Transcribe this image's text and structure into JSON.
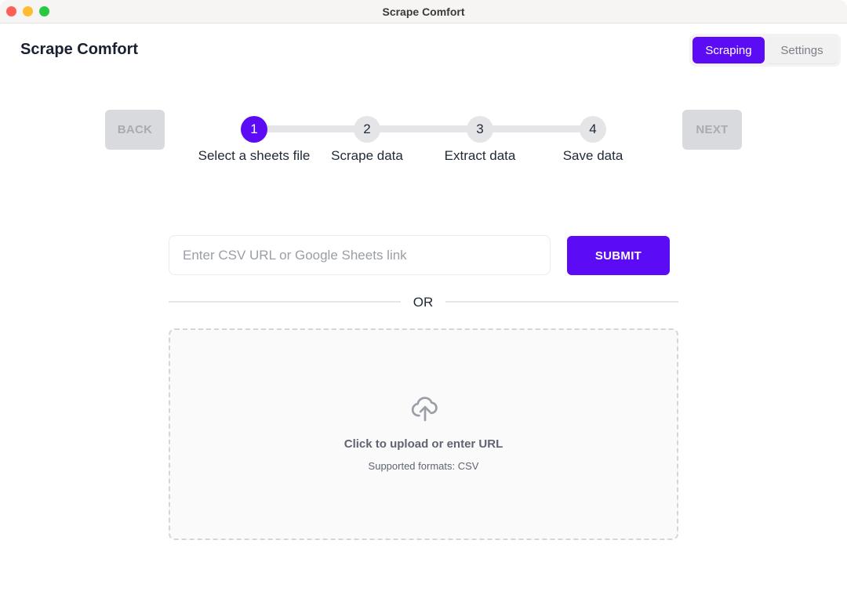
{
  "window": {
    "title": "Scrape Comfort"
  },
  "header": {
    "app_title": "Scrape Comfort",
    "tabs": [
      {
        "label": "Scraping",
        "active": true
      },
      {
        "label": "Settings",
        "active": false
      }
    ]
  },
  "wizard": {
    "back_label": "BACK",
    "next_label": "NEXT",
    "current_step": 1,
    "steps": [
      {
        "number": "1",
        "label": "Select a sheets file",
        "active": true
      },
      {
        "number": "2",
        "label": "Scrape data",
        "active": false
      },
      {
        "number": "3",
        "label": "Extract data",
        "active": false
      },
      {
        "number": "4",
        "label": "Save data",
        "active": false
      }
    ]
  },
  "source": {
    "url_input": {
      "value": "",
      "placeholder": "Enter CSV URL or Google Sheets link"
    },
    "submit_label": "SUBMIT",
    "divider_label": "OR",
    "dropzone": {
      "icon": "cloud-upload-icon",
      "title": "Click to upload or enter URL",
      "subtitle": "Supported formats: CSV"
    }
  },
  "colors": {
    "accent": "#5b0cf5",
    "disabled_button": "#d9dadd",
    "step_idle": "#e5e5e7"
  }
}
